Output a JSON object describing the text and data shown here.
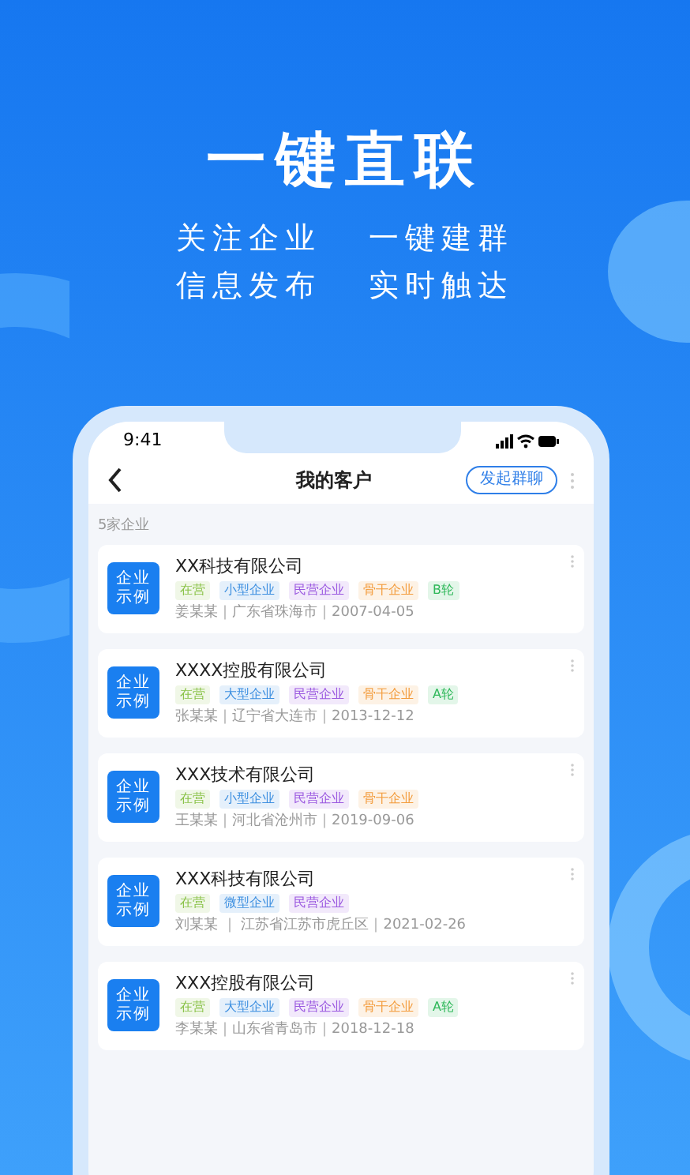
{
  "headline": "一键直联",
  "features": [
    "关注企业",
    "一键建群",
    "信息发布",
    "实时触达"
  ],
  "phone": {
    "status_time": "9:41",
    "nav_title": "我的客户",
    "nav_button": "发起群聊",
    "count": "5家企业",
    "customers": [
      {
        "logo": [
          "企业",
          "示例"
        ],
        "name": "XX科技有限公司",
        "tags": [
          {
            "text": "在营",
            "color": "#8bc34a"
          },
          {
            "text": "小型企业",
            "color": "#3d8fe0"
          },
          {
            "text": "民营企业",
            "color": "#9b59e0"
          },
          {
            "text": "骨干企业",
            "color": "#f39c3c"
          },
          {
            "text": "B轮",
            "color": "#2fb85a"
          }
        ],
        "meta": "姜某某｜广东省珠海市｜2007-04-05"
      },
      {
        "logo": [
          "企业",
          "示例"
        ],
        "name": "XXXX控股有限公司",
        "tags": [
          {
            "text": "在营",
            "color": "#8bc34a"
          },
          {
            "text": "大型企业",
            "color": "#3d8fe0"
          },
          {
            "text": "民营企业",
            "color": "#9b59e0"
          },
          {
            "text": "骨干企业",
            "color": "#f39c3c"
          },
          {
            "text": "A轮",
            "color": "#2fb85a"
          }
        ],
        "meta": "张某某｜辽宁省大连市｜2013-12-12"
      },
      {
        "logo": [
          "企业",
          "示例"
        ],
        "name": "XXX技术有限公司",
        "tags": [
          {
            "text": "在营",
            "color": "#8bc34a"
          },
          {
            "text": "小型企业",
            "color": "#3d8fe0"
          },
          {
            "text": "民营企业",
            "color": "#9b59e0"
          },
          {
            "text": "骨干企业",
            "color": "#f39c3c"
          }
        ],
        "meta": "王某某｜河北省沧州市｜2019-09-06"
      },
      {
        "logo": [
          "企业",
          "示例"
        ],
        "name": "XXX科技有限公司",
        "tags": [
          {
            "text": "在营",
            "color": "#8bc34a"
          },
          {
            "text": "微型企业",
            "color": "#3d8fe0"
          },
          {
            "text": "民营企业",
            "color": "#9b59e0"
          }
        ],
        "meta": "刘某某 ｜ 江苏省江苏市虎丘区｜2021-02-26"
      },
      {
        "logo": [
          "企业",
          "示例"
        ],
        "name": "XXX控股有限公司",
        "tags": [
          {
            "text": "在营",
            "color": "#8bc34a"
          },
          {
            "text": "大型企业",
            "color": "#3d8fe0"
          },
          {
            "text": "民营企业",
            "color": "#9b59e0"
          },
          {
            "text": "骨干企业",
            "color": "#f39c3c"
          },
          {
            "text": "A轮",
            "color": "#2fb85a"
          }
        ],
        "meta": "李某某｜山东省青岛市｜2018-12-18"
      }
    ]
  }
}
